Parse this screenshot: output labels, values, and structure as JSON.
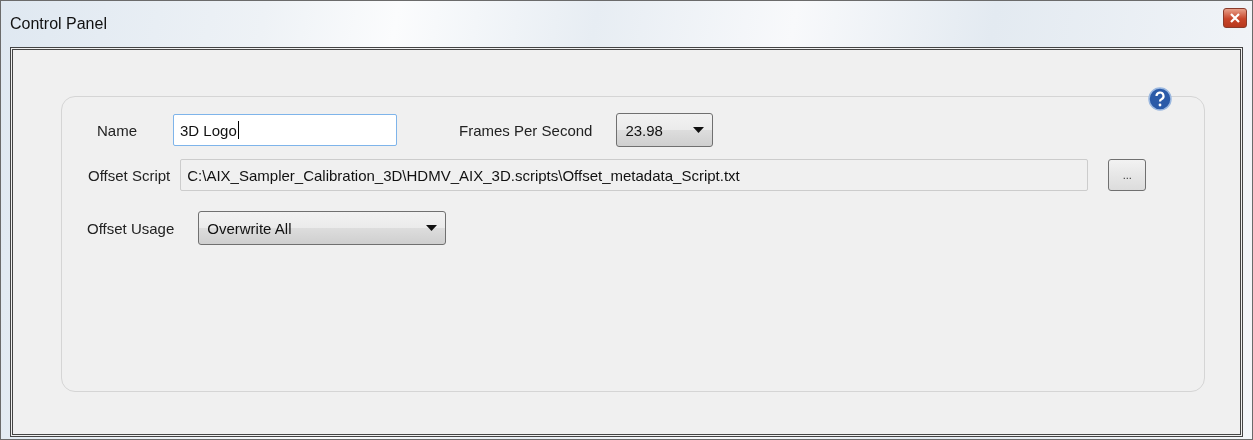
{
  "window": {
    "title": "Control Panel"
  },
  "name_field": {
    "label": "Name",
    "value": "3D Logo",
    "focused": true
  },
  "fps": {
    "label": "Frames Per Second",
    "value": "23.98"
  },
  "offset_script": {
    "label": "Offset Script",
    "value": "C:\\AIX_Sampler_Calibration_3D\\HDMV_AIX_3D.scripts\\Offset_metadata_Script.txt",
    "browse": "..."
  },
  "offset_usage": {
    "label": "Offset Usage",
    "value": "Overwrite All"
  }
}
